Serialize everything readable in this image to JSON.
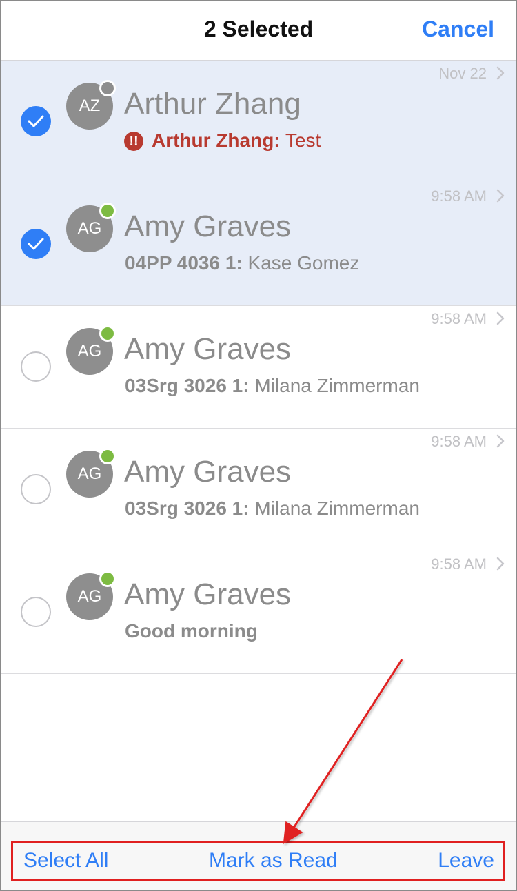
{
  "header": {
    "title": "2 Selected",
    "cancel_label": "Cancel"
  },
  "conversations": [
    {
      "initials": "AZ",
      "name": "Arthur Zhang",
      "time": "Nov 22",
      "sender": "Arthur Zhang:",
      "message": " Test",
      "selected": true,
      "presence": "offline",
      "urgent": true
    },
    {
      "initials": "AG",
      "name": "Amy Graves",
      "time": "9:58 AM",
      "sender": "04PP 4036 1:",
      "message": " Kase Gomez",
      "selected": true,
      "presence": "online",
      "urgent": false
    },
    {
      "initials": "AG",
      "name": "Amy Graves",
      "time": "9:58 AM",
      "sender": "03Srg 3026 1:",
      "message": " Milana Zimmerman",
      "selected": false,
      "presence": "online",
      "urgent": false
    },
    {
      "initials": "AG",
      "name": "Amy Graves",
      "time": "9:58 AM",
      "sender": "03Srg 3026 1:",
      "message": " Milana Zimmerman",
      "selected": false,
      "presence": "online",
      "urgent": false
    },
    {
      "initials": "AG",
      "name": "Amy Graves",
      "time": "9:58 AM",
      "sender": "Good morning",
      "message": "",
      "selected": false,
      "presence": "online",
      "urgent": false
    }
  ],
  "toolbar": {
    "select_all_label": "Select All",
    "mark_read_label": "Mark as Read",
    "leave_label": "Leave"
  },
  "icons": {
    "check": "checkmark-icon",
    "chevron": "chevron-right-icon",
    "urgent": "exclamation-icon",
    "urgent_glyph": "!!"
  },
  "colors": {
    "accent": "#2f7ef6",
    "selected_row": "#e7edf8",
    "urgent": "#b83a30",
    "online": "#7dbb42",
    "offline": "#8e8e8e",
    "annotation": "#e02020"
  }
}
